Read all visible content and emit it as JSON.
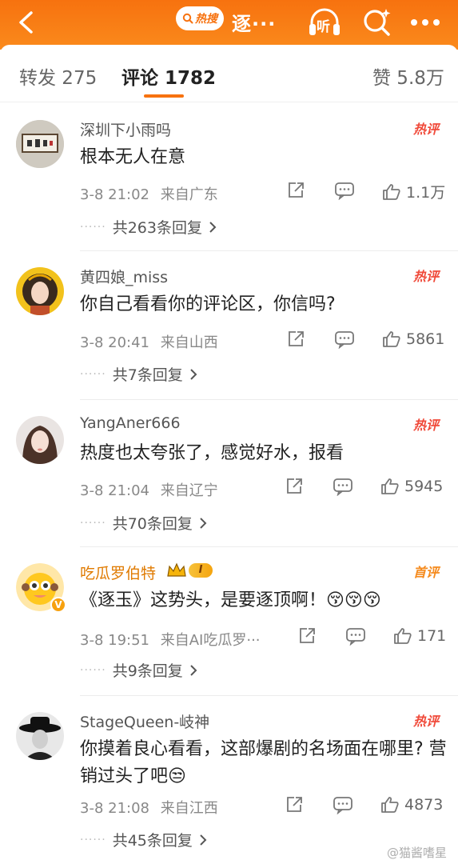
{
  "header": {
    "hot_label": "热搜",
    "title": "逐···",
    "listen_label": "听"
  },
  "tabs": [
    {
      "label": "转发 275"
    },
    {
      "label": "评论 1782"
    },
    {
      "label": "赞 5.8万"
    }
  ],
  "comments": [
    {
      "username": "深圳下小雨吗",
      "badge": "热评",
      "text": "根本无人在意",
      "time": "3-8 21:02",
      "location": "来自广东",
      "likes": "1.1万",
      "replies": "共263条回复"
    },
    {
      "username": "黄四娘_miss",
      "badge": "热评",
      "text": "你自己看看你的评论区，你信吗?",
      "time": "3-8 20:41",
      "location": "来自山西",
      "likes": "5861",
      "replies": "共7条回复"
    },
    {
      "username": "YangAner666",
      "badge": "热评",
      "text": "热度也太夸张了，感觉好水，报看",
      "time": "3-8 21:04",
      "location": "来自辽宁",
      "likes": "5945",
      "replies": "共70条回复"
    },
    {
      "username": "吃瓜罗伯特",
      "badge": "首评",
      "text": "《逐玉》这势头，是要逐顶啊！😚😚😚",
      "time": "3-8 19:51",
      "location": "来自AI吃瓜罗···",
      "likes": "171",
      "replies": "共9条回复",
      "vip_level": "I"
    },
    {
      "username": "StageQueen-岐神",
      "badge": "热评",
      "text": "你摸着良心看看，这部爆剧的名场面在哪里? 营销过头了吧😒",
      "time": "3-8 21:08",
      "location": "来自江西",
      "likes": "4873",
      "replies": "共45条回复"
    }
  ],
  "watermark": "@猫酱嗜星",
  "colors": {
    "brand_orange": "#f7720f",
    "hot_red": "#f04a3a"
  }
}
